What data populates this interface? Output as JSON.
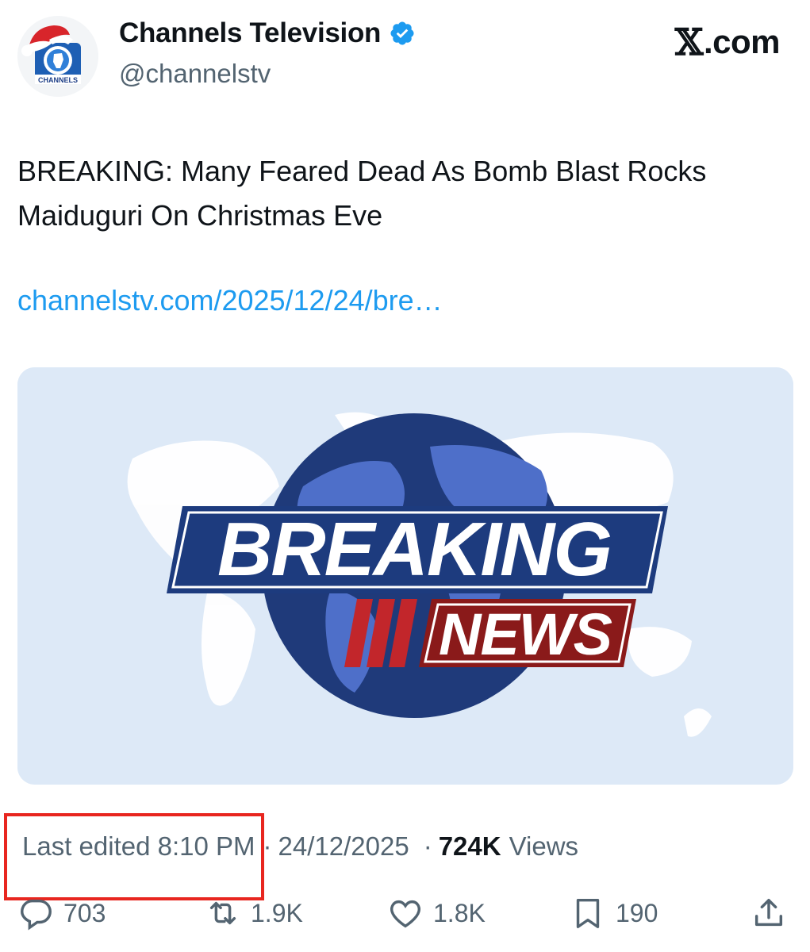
{
  "account": {
    "display_name": "Channels Television",
    "handle": "@channelstv",
    "verified": true,
    "avatar_label": "CHANNELS"
  },
  "brand": {
    "label": ".com",
    "glyph": "𝕏"
  },
  "tweet": {
    "text": "BREAKING: Many Feared Dead As Bomb Blast Rocks Maiduguri On Christmas Eve",
    "link": "channelstv.com/2025/12/24/bre…",
    "media_text": {
      "line1": "BREAKING",
      "line2": "NEWS"
    }
  },
  "meta": {
    "edited_label": "Last edited 8:10 PM",
    "separator": "·",
    "date": "24/12/2025",
    "views_count": "724K",
    "views_label": "Views"
  },
  "actions": {
    "replies": "703",
    "reposts": "1.9K",
    "likes": "1.8K",
    "bookmarks": "190"
  },
  "colors": {
    "link": "#1d9bf0",
    "verified": "#1d9bf0",
    "highlight_box": "#e8261f",
    "media_bg": "#dde9f7",
    "globe": "#1f3a7a",
    "breaking_banner": "#1d3b7e",
    "news_banner": "#8a1a1a"
  },
  "icons": [
    "verified-badge-icon",
    "reply-icon",
    "repost-icon",
    "like-icon",
    "bookmark-icon",
    "share-icon",
    "santa-hat-icon",
    "channels-logo-icon"
  ]
}
